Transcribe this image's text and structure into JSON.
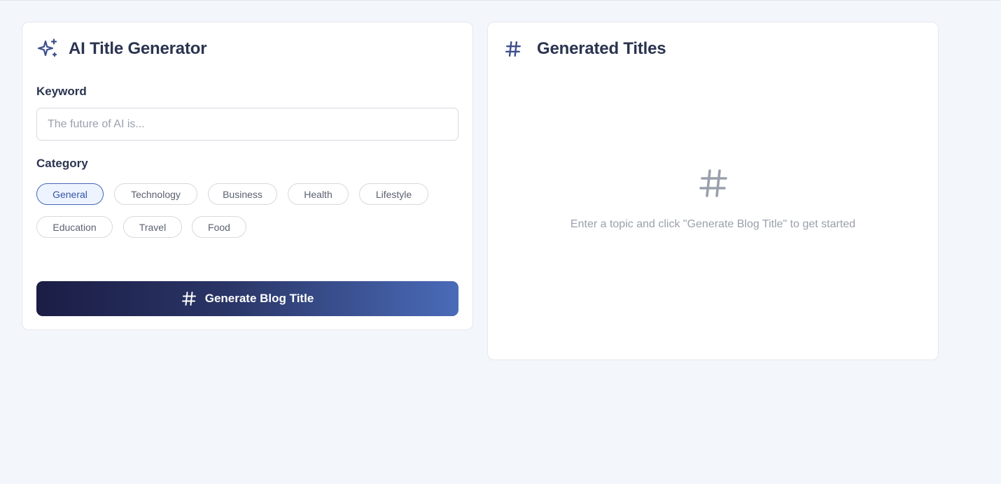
{
  "generator": {
    "title": "AI Title Generator",
    "icon": "sparkles-icon",
    "keyword_label": "Keyword",
    "keyword_value": "",
    "keyword_placeholder": "The future of AI is...",
    "category_label": "Category",
    "categories": [
      {
        "label": "General",
        "selected": true
      },
      {
        "label": "Technology",
        "selected": false
      },
      {
        "label": "Business",
        "selected": false
      },
      {
        "label": "Health",
        "selected": false
      },
      {
        "label": "Lifestyle",
        "selected": false
      },
      {
        "label": "Education",
        "selected": false
      },
      {
        "label": "Travel",
        "selected": false
      },
      {
        "label": "Food",
        "selected": false
      }
    ],
    "button_label": "Generate Blog Title",
    "button_icon": "hash-icon"
  },
  "results": {
    "title": "Generated Titles",
    "icon": "hash-icon",
    "empty_icon": "hash-icon",
    "empty_text": "Enter a topic and click \"Generate Blog Title\" to get started"
  },
  "colors": {
    "accent": "#3d4f8c",
    "selected_chip_border": "#4466b5",
    "button_gradient_start": "#1b1d45",
    "button_gradient_end": "#4a6bb8",
    "page_background": "#f3f6fb"
  }
}
